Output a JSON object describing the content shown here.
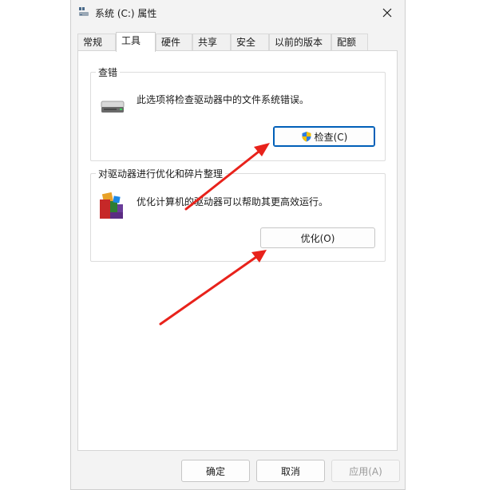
{
  "window": {
    "title": "系统 (C:) 属性",
    "close_symbol": "✕"
  },
  "tabs": [
    {
      "label": "常规"
    },
    {
      "label": "工具",
      "active": true
    },
    {
      "label": "硬件"
    },
    {
      "label": "共享"
    },
    {
      "label": "安全"
    },
    {
      "label": "以前的版本"
    },
    {
      "label": "配额"
    }
  ],
  "error_check": {
    "group_title": "查错",
    "description": "此选项将检查驱动器中的文件系统错误。",
    "button_label": "检查(C)"
  },
  "optimize": {
    "group_title": "对驱动器进行优化和碎片整理",
    "description": "优化计算机的驱动器可以帮助其更高效运行。",
    "button_label": "优化(O)"
  },
  "footer": {
    "ok_label": "确定",
    "cancel_label": "取消",
    "apply_label": "应用(A)"
  },
  "colors": {
    "accent": "#005fb8",
    "annotation_arrow": "#e8221b"
  },
  "icons": [
    "drive-properties-icon",
    "close-icon",
    "hard-drive-icon",
    "uac-shield-icon",
    "defrag-icon"
  ]
}
